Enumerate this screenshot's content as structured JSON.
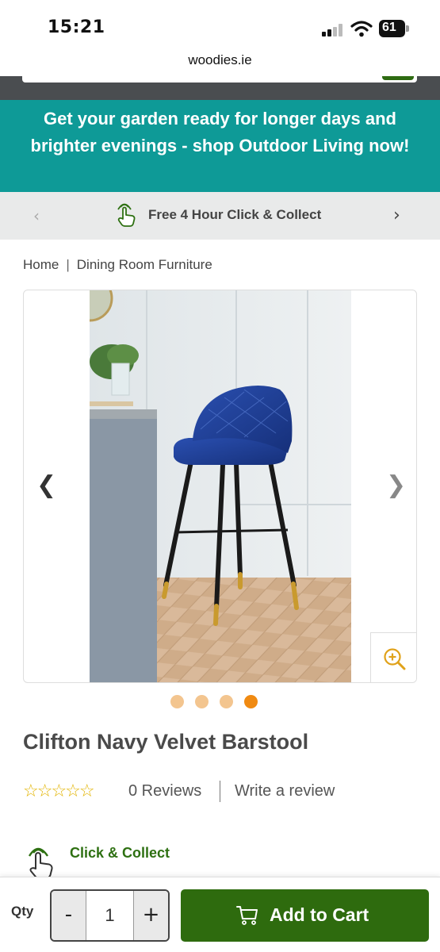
{
  "status_bar": {
    "time": "15:21",
    "battery": "61"
  },
  "browser": {
    "url": "woodies.ie"
  },
  "promo_banner": {
    "text": "Get your garden ready for longer days and brighter evenings - shop Outdoor Living now!"
  },
  "click_collect_bar": {
    "text": "Free 4 Hour Click & Collect",
    "prev_icon": "chevron-left-icon",
    "next_icon": "chevron-right-icon"
  },
  "breadcrumb": {
    "items": [
      "Home",
      "Dining Room Furniture"
    ],
    "separator": "|"
  },
  "gallery": {
    "image_alt": "Clifton Navy Velvet Barstool",
    "slide_count": 4,
    "active_slide": 4,
    "zoom_icon": "zoom-in-icon"
  },
  "product": {
    "title": "Clifton Navy Velvet Barstool",
    "rating_stars": 0,
    "reviews_label": "0 Reviews",
    "write_review_label": "Write a review"
  },
  "fulfilment": {
    "click_collect_label": "Click & Collect"
  },
  "cart_bar": {
    "qty_label": "Qty",
    "minus_label": "-",
    "plus_label": "+",
    "quantity": "1",
    "add_to_cart_label": "Add to Cart"
  },
  "colors": {
    "promo_bg": "#0e9a97",
    "brand_green": "#2e6b0e",
    "dot_active": "#f08a12",
    "dot_inactive": "#f3c58f",
    "star": "#e2b400"
  }
}
